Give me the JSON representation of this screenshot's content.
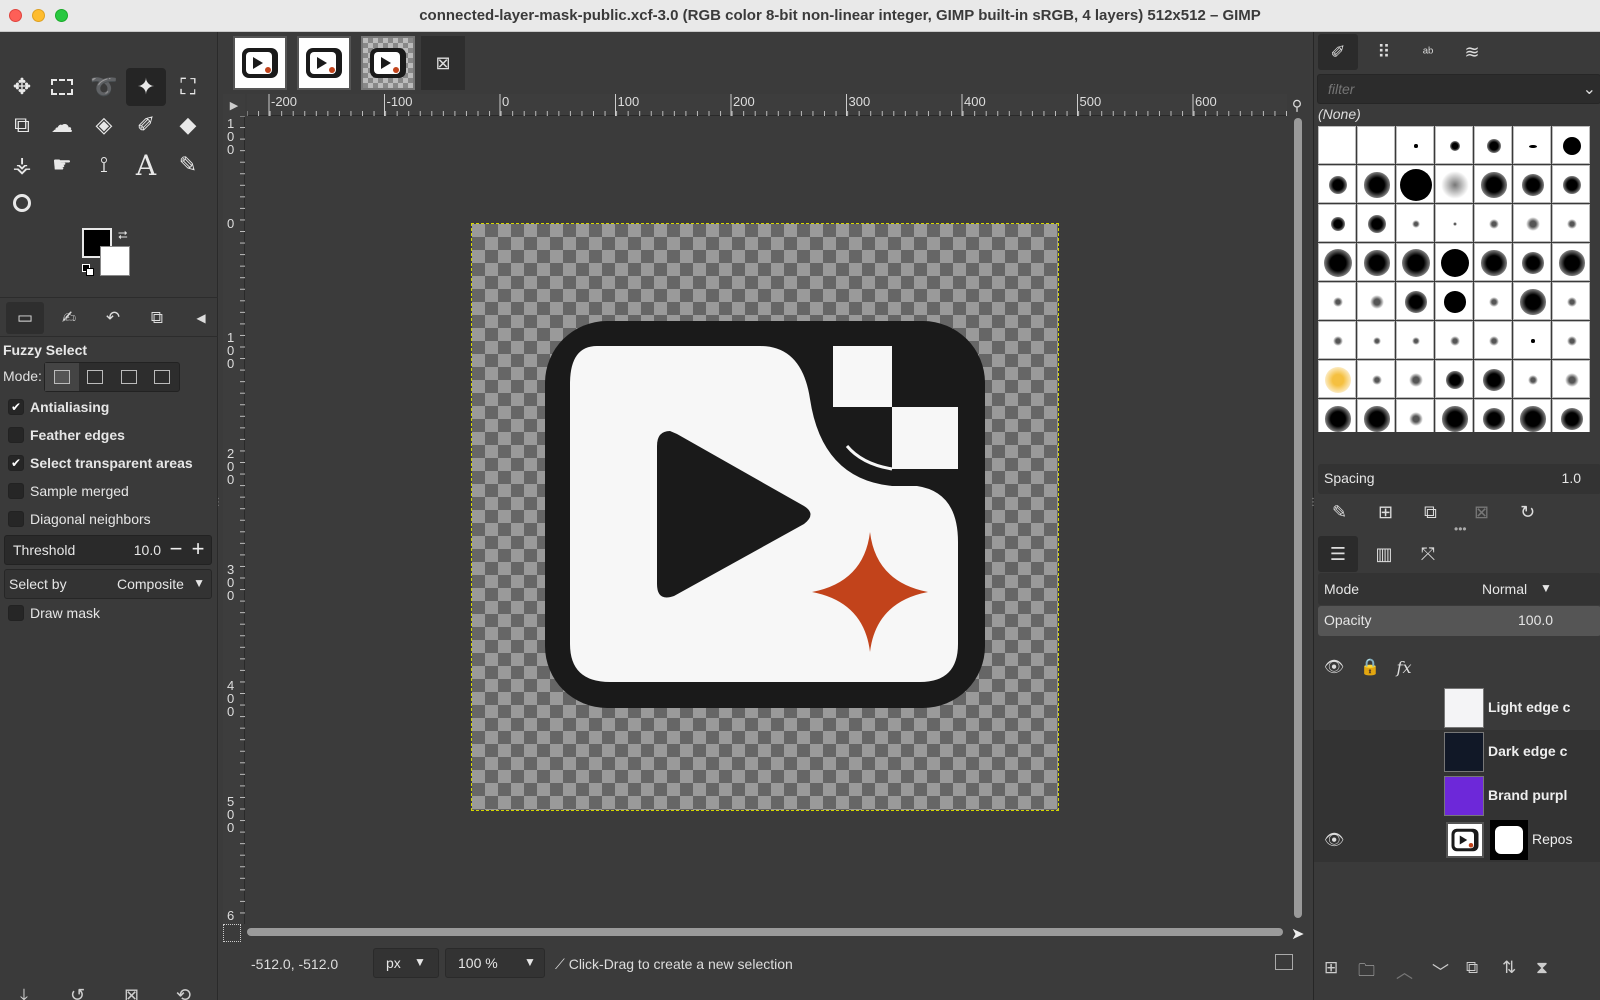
{
  "window": {
    "title": "connected-layer-mask-public.xcf-3.0 (RGB color 8-bit non-linear integer, GIMP built-in sRGB, 4 layers) 512x512 – GIMP"
  },
  "toolbox": {
    "tools": [
      {
        "name": "move-tool-icon",
        "glyph": "✥"
      },
      {
        "name": "rect-select-tool-icon",
        "glyph": "▭"
      },
      {
        "name": "free-select-tool-icon",
        "glyph": "➰"
      },
      {
        "name": "fuzzy-select-tool-icon",
        "glyph": "⚡",
        "active": true
      },
      {
        "name": "crop-tool-icon",
        "glyph": "⛶"
      },
      {
        "name": "unified-transform-tool-icon",
        "glyph": "⧉"
      },
      {
        "name": "warp-transform-tool-icon",
        "glyph": "☁"
      },
      {
        "name": "bucket-fill-tool-icon",
        "glyph": "⛾"
      },
      {
        "name": "paintbrush-tool-icon",
        "glyph": "🖌"
      },
      {
        "name": "eraser-tool-icon",
        "glyph": "⌫"
      },
      {
        "name": "clone-tool-icon",
        "glyph": "⚶"
      },
      {
        "name": "smudge-tool-icon",
        "glyph": "☛"
      },
      {
        "name": "paths-tool-icon",
        "glyph": "⟟"
      },
      {
        "name": "text-tool-icon",
        "glyph": "A"
      },
      {
        "name": "color-picker-tool-icon",
        "glyph": "✎"
      },
      {
        "name": "zoom-tool-icon",
        "glyph": "🔍"
      }
    ],
    "colors": {
      "foreground": "#000000",
      "background": "#ffffff"
    }
  },
  "tool_options": {
    "title": "Fuzzy Select",
    "mode_label": "Mode:",
    "checkboxes": [
      {
        "label": "Antialiasing",
        "checked": true
      },
      {
        "label": "Feather edges",
        "checked": false
      },
      {
        "label": "Select transparent areas",
        "checked": true
      },
      {
        "label": "Sample merged",
        "checked": false
      },
      {
        "label": "Diagonal neighbors",
        "checked": false
      }
    ],
    "threshold": {
      "label": "Threshold",
      "value": "10.0"
    },
    "select_by": {
      "label": "Select by",
      "value": "Composite"
    },
    "draw_mask": {
      "label": "Draw mask",
      "checked": false
    }
  },
  "rulers": {
    "horizontal": [
      "-200",
      "-100",
      "0",
      "100",
      "200",
      "300",
      "400",
      "500",
      "600",
      "7"
    ],
    "vertical": [
      "1 0 0",
      "0",
      "1 0 0",
      "2 0 0",
      "3 0 0",
      "4 0 0",
      "5 0 0",
      "6"
    ]
  },
  "status": {
    "coords": "-512.0, -512.0",
    "unit": "px",
    "zoom": "100 %",
    "message": "Click-Drag to create a new selection"
  },
  "brushes": {
    "filter_placeholder": "filter",
    "selected_name": "(None)",
    "spacing": {
      "label": "Spacing",
      "value": "1.0"
    }
  },
  "layers": {
    "mode": {
      "label": "Mode",
      "value": "Normal"
    },
    "opacity": {
      "label": "Opacity",
      "value": "100.0"
    },
    "items": [
      {
        "name": "Light edge c",
        "color": "#f4f4f6",
        "visible": false
      },
      {
        "name": "Dark edge c",
        "color": "#111827",
        "visible": false
      },
      {
        "name": "Brand purpl",
        "color": "#6d28d9",
        "visible": false
      },
      {
        "name": "Repos",
        "visible": true
      }
    ]
  },
  "canvas": {
    "colors": {
      "frame": "#1a1a1a",
      "inner": "#f7f7f7",
      "accent": "#c2431b"
    }
  }
}
